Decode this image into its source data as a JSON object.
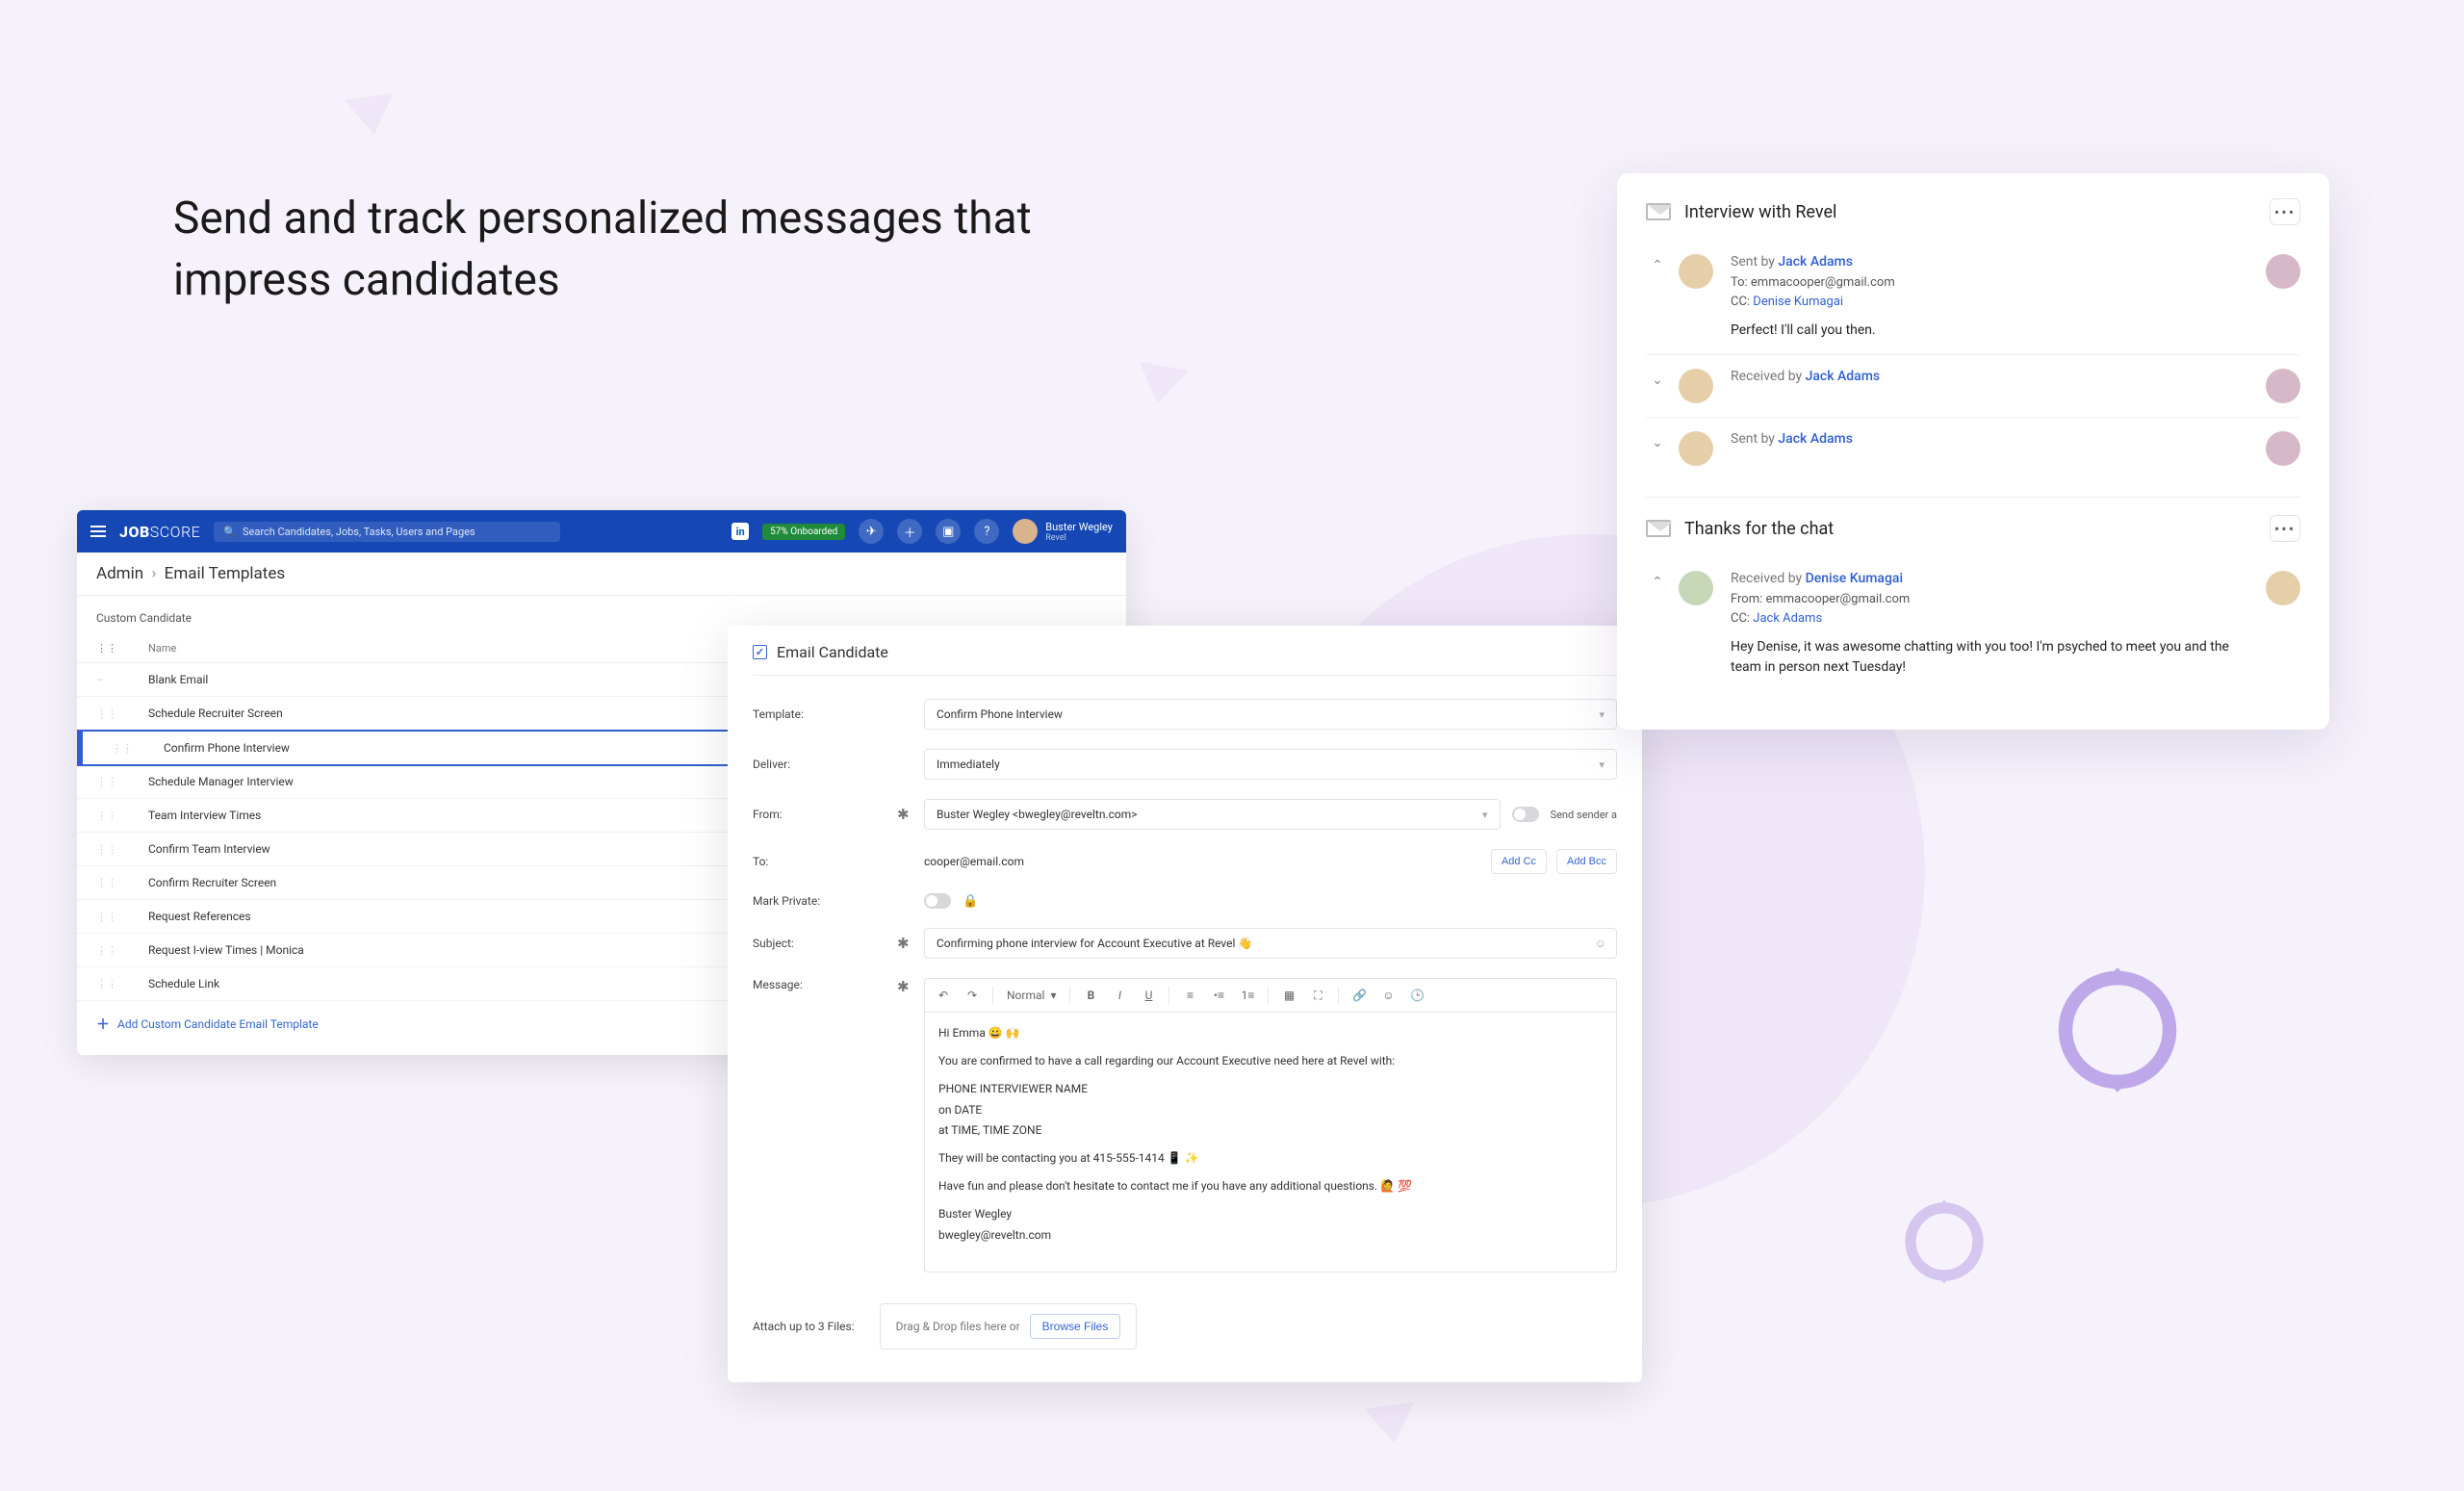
{
  "headline": "Send and track personalized messages that impress candidates",
  "topbar": {
    "search_placeholder": "Search Candidates, Jobs, Tasks, Users and Pages",
    "linkedin_label": "in",
    "onboarded_label": "57% Onboarded",
    "user_name": "Buster Wegley",
    "user_company": "Revel"
  },
  "breadcrumb": {
    "root": "Admin",
    "page": "Email Templates"
  },
  "section_title": "Custom Candidate",
  "tmpl_header_name": "Name",
  "templates": [
    "Blank Email",
    "Schedule Recruiter Screen",
    "Confirm Phone Interview",
    "Schedule Manager Interview",
    "Team Interview Times",
    "Confirm Team Interview",
    "Confirm Recruiter Screen",
    "Request References",
    "Request I-view Times | Monica",
    "Schedule Link"
  ],
  "templates_active_index": 2,
  "add_template_label": "Add Custom Candidate Email Template",
  "compose": {
    "title": "Email Candidate",
    "labels": {
      "template": "Template:",
      "deliver": "Deliver:",
      "from": "From:",
      "to": "To:",
      "mark_private": "Mark Private:",
      "subject": "Subject:",
      "message": "Message:",
      "attach": "Attach up to 3 Files:"
    },
    "template_value": "Confirm Phone Interview",
    "deliver_value": "Immediately",
    "from_value": "Buster Wegley <bwegley@reveltn.com>",
    "send_sender_label": "Send sender a",
    "to_value": "cooper@email.com",
    "add_cc_label": "Add Cc",
    "add_bcc_label": "Add Bcc",
    "subject_value": "Confirming phone interview for Account Executive at Revel 👋",
    "toolbar_normal": "Normal",
    "body_greeting": "Hi Emma 😀 🙌",
    "body_line1": "You are confirmed to have a call regarding our Account Executive need here at Revel with:",
    "body_line2": "PHONE INTERVIEWER NAME",
    "body_line3": "on DATE",
    "body_line4": "at TIME, TIME ZONE",
    "body_line5": "They will be contacting you at 415-555-1414 📱 ✨",
    "body_line6": "Have fun and please don't hesitate to contact me if you have any additional questions. 🙋 💯",
    "body_sig1": "Buster Wegley",
    "body_sig2": "bwegley@reveltn.com",
    "drop_text": "Drag & Drop files here or",
    "browse_label": "Browse Files"
  },
  "thread": {
    "subject1": "Interview with Revel",
    "msg1": {
      "sent_by_prefix": "Sent by ",
      "sent_by": "Jack Adams",
      "to_line": "To: emmacooper@gmail.com",
      "cc_prefix": "CC: ",
      "cc_name": "Denise Kumagai",
      "body": "Perfect!  I'll call you then."
    },
    "msg2": {
      "prefix": "Received by ",
      "name": "Jack Adams"
    },
    "msg3": {
      "prefix": "Sent by ",
      "name": "Jack Adams"
    },
    "subject2": "Thanks for the chat",
    "msg4": {
      "prefix": "Received by ",
      "name": "Denise Kumagai",
      "from_line": "From: emmacooper@gmail.com",
      "cc_prefix": "CC: ",
      "cc_name": "Jack Adams",
      "body": "Hey Denise, it was awesome chatting with you too!  I'm psyched to meet you and the team in person next Tuesday!"
    }
  }
}
